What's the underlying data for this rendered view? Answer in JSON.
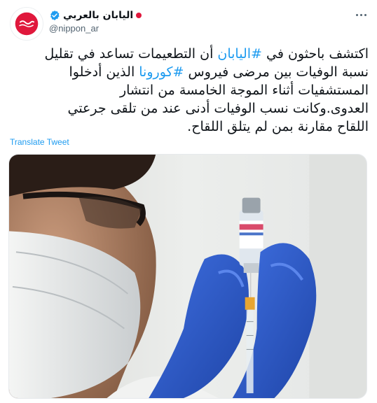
{
  "author": {
    "display_name": "اليابان بالعربي",
    "handle": "@nippon_ar",
    "avatar_icon": "nippon-logo-icon",
    "verified_icon": "verified-badge-icon"
  },
  "tweet": {
    "lines": [
      [
        {
          "text": "اكتشف باحثون في ",
          "hashtag": false
        },
        {
          "text": "#اليابان",
          "hashtag": true
        },
        {
          "text": " أن التطعيمات تساعد في تقليل",
          "hashtag": false
        }
      ],
      [
        {
          "text": "نسبة الوفيات بين مرضى فيروس ",
          "hashtag": false
        },
        {
          "text": "#كورونا",
          "hashtag": true
        },
        {
          "text": " الذين أدخلوا",
          "hashtag": false
        }
      ],
      [
        {
          "text": "المستشفيات أثناء الموجة الخامسة من انتشار",
          "hashtag": false
        }
      ],
      [
        {
          "text": "العدوى.وكانت نسب الوفيات أدنى عند من تلقى جرعتي",
          "hashtag": false
        }
      ],
      [
        {
          "text": "اللقاح مقارنة بمن لم يتلق اللقاح.",
          "hashtag": false
        }
      ]
    ],
    "translate_label": "Translate Tweet"
  },
  "colors": {
    "link": "#1d9bf0",
    "text": "#0f1419",
    "secondary": "#536471",
    "glove": "#2f5fd0",
    "brand_red": "#e0183c"
  }
}
